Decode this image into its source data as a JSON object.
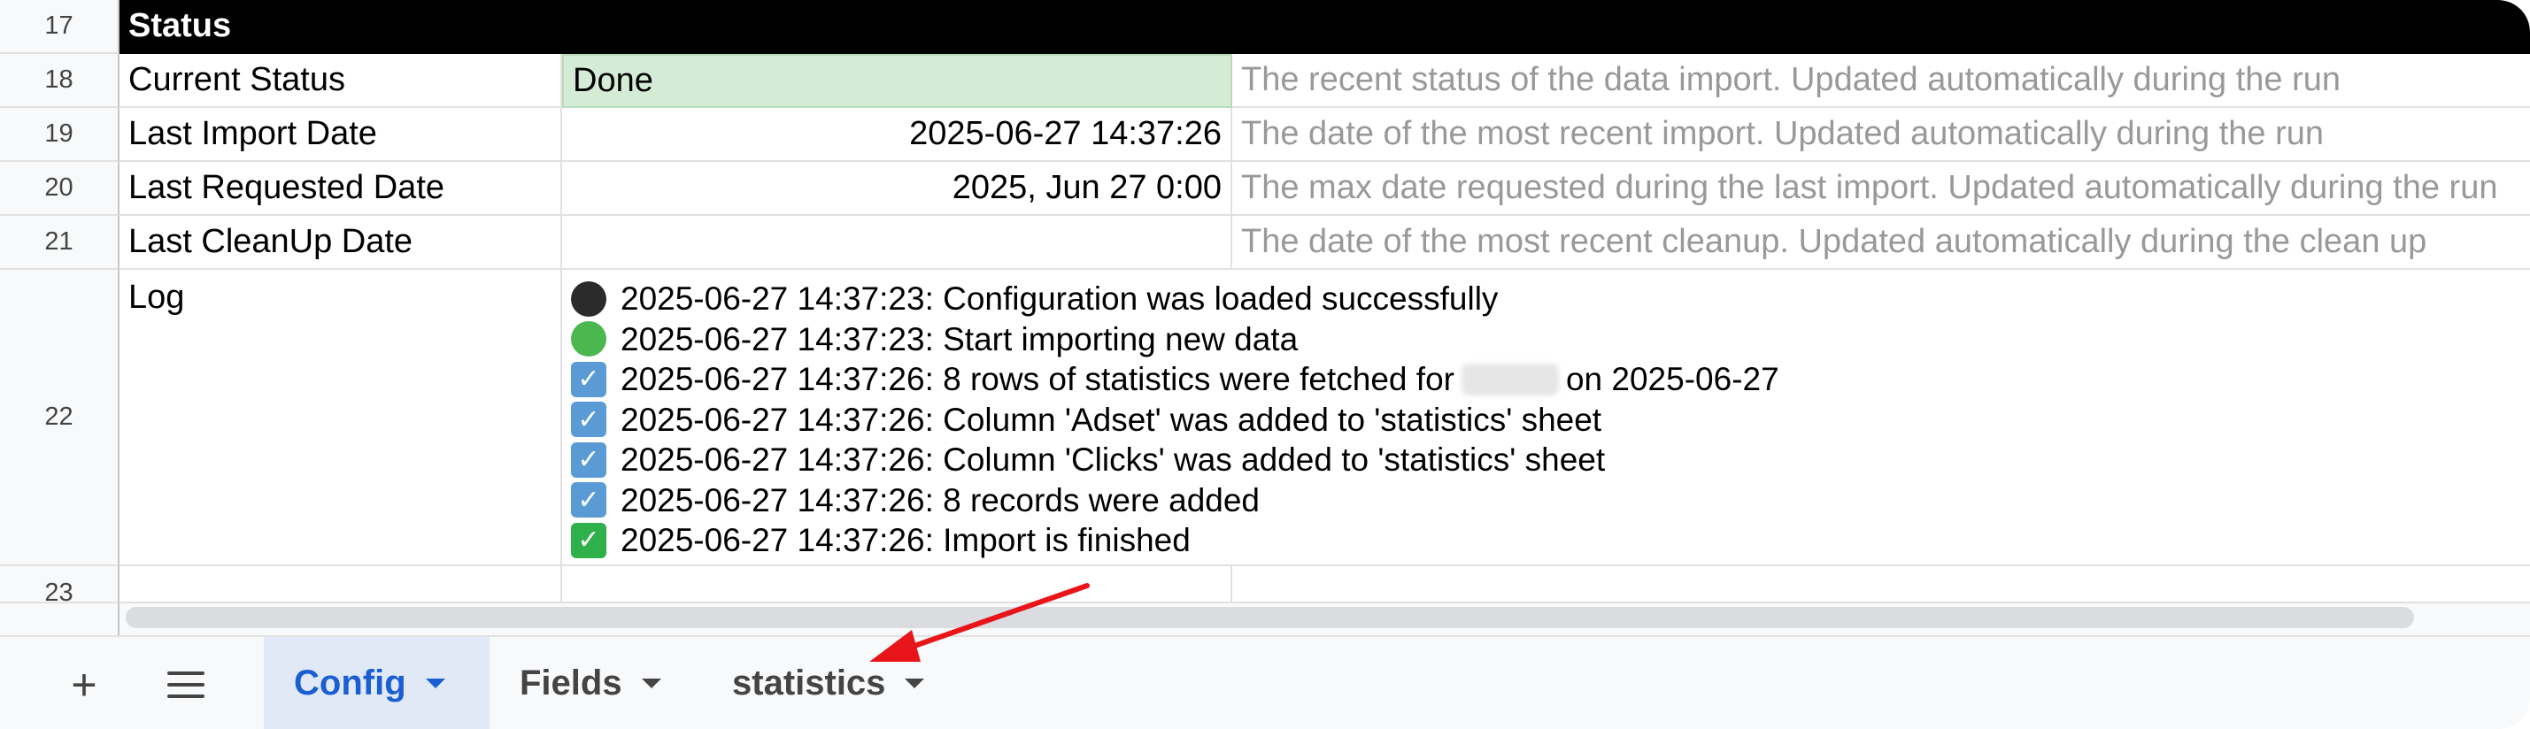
{
  "rows": {
    "r17": {
      "num": "17",
      "a": "Status",
      "b": "",
      "c": ""
    },
    "r18": {
      "num": "18",
      "a": "Current Status",
      "b": "Done",
      "c": "The recent status of the data import. Updated automatically during the run"
    },
    "r19": {
      "num": "19",
      "a": "Last Import Date",
      "b": "2025-06-27 14:37:26",
      "c": "The date of the most recent import. Updated automatically during the run"
    },
    "r20": {
      "num": "20",
      "a": "Last Requested Date",
      "b": "2025, Jun 27 0:00",
      "c": "The max date requested during the last import. Updated automatically during the run"
    },
    "r21": {
      "num": "21",
      "a": "Last CleanUp Date",
      "b": "",
      "c": "The date of the most recent cleanup. Updated automatically during the clean up"
    },
    "r22": {
      "num": "22",
      "a": "Log"
    },
    "r23": {
      "num": "23"
    }
  },
  "log": [
    {
      "icon": "black-circle-icon",
      "text": "2025-06-27 14:37:23: Configuration was loaded successfully"
    },
    {
      "icon": "green-circle-icon",
      "text": "2025-06-27 14:37:23: Start importing new data"
    },
    {
      "icon": "ballot-check-icon",
      "text_pre": "2025-06-27 14:37:26: 8 rows of statistics were fetched for",
      "text_post": "on 2025-06-27"
    },
    {
      "icon": "ballot-check-icon",
      "text": "2025-06-27 14:37:26: Column 'Adset' was added to 'statistics' sheet"
    },
    {
      "icon": "ballot-check-icon",
      "text": "2025-06-27 14:37:26: Column 'Clicks' was added to 'statistics' sheet"
    },
    {
      "icon": "ballot-check-icon",
      "text": "2025-06-27 14:37:26: 8 records were added"
    },
    {
      "icon": "check-mark-button-icon",
      "text": "2025-06-27 14:37:26: Import is finished"
    }
  ],
  "tabs": [
    {
      "label": "Config",
      "active": true
    },
    {
      "label": "Fields",
      "active": false
    },
    {
      "label": "statistics",
      "active": false
    }
  ],
  "toolbar": {
    "add_sheet": "+"
  },
  "colors": {
    "header_bg": "#000000",
    "done_bg": "#d4ecd6",
    "active_tab_text": "#1a5fd1",
    "annotation_arrow": "#e8161b"
  }
}
